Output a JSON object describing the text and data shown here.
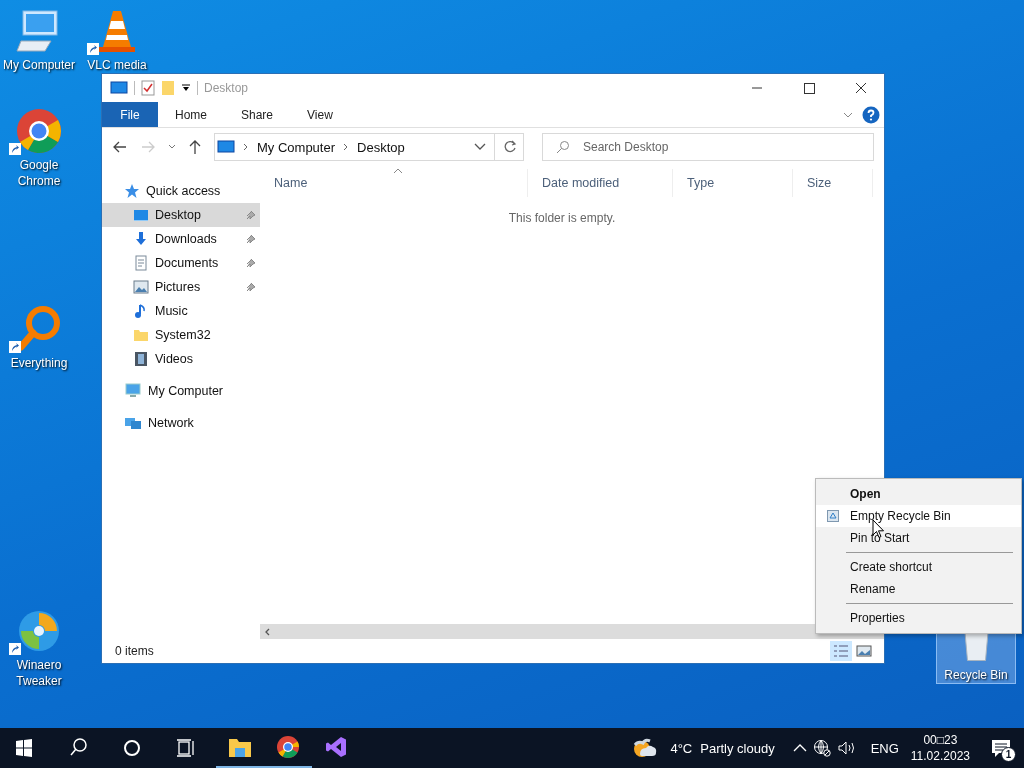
{
  "desktop_icons": [
    {
      "label": "My Computer",
      "kind": "computer",
      "shortcut": false,
      "selected": false
    },
    {
      "label": "VLC media",
      "kind": "cone",
      "shortcut": true,
      "selected": false
    },
    {
      "label": "Google Chrome",
      "kind": "chrome",
      "shortcut": true,
      "selected": false
    },
    {
      "label": "Everything",
      "kind": "magnifier",
      "shortcut": true,
      "selected": false
    },
    {
      "label": "Winaero Tweaker",
      "kind": "swirl",
      "shortcut": true,
      "selected": false
    },
    {
      "label": "Recycle Bin",
      "kind": "bin",
      "shortcut": false,
      "selected": true
    }
  ],
  "window": {
    "title": "Desktop",
    "ribbon_tabs": [
      {
        "label": "File",
        "selected": true
      },
      {
        "label": "Home",
        "selected": false
      },
      {
        "label": "Share",
        "selected": false
      },
      {
        "label": "View",
        "selected": false
      }
    ],
    "address": [
      "My Computer",
      "Desktop"
    ],
    "search": {
      "placeholder": "Search Desktop"
    },
    "nav": [
      {
        "label": "Quick access",
        "kind": "star",
        "children": [
          {
            "label": "Desktop",
            "kind": "desktop",
            "pinned": true,
            "selected": true
          },
          {
            "label": "Downloads",
            "kind": "download",
            "pinned": true,
            "selected": false
          },
          {
            "label": "Documents",
            "kind": "document",
            "pinned": true,
            "selected": false
          },
          {
            "label": "Pictures",
            "kind": "pictures",
            "pinned": true,
            "selected": false
          },
          {
            "label": "Music",
            "kind": "music",
            "pinned": false,
            "selected": false
          },
          {
            "label": "System32",
            "kind": "folder",
            "pinned": false,
            "selected": false
          },
          {
            "label": "Videos",
            "kind": "video",
            "pinned": false,
            "selected": false
          }
        ]
      },
      {
        "label": "My Computer",
        "kind": "computer"
      },
      {
        "label": "Network",
        "kind": "network"
      }
    ],
    "columns": [
      "Name",
      "Date modified",
      "Type",
      "Size"
    ],
    "empty_message": "This folder is empty.",
    "status": "0 items"
  },
  "context_menu": [
    {
      "kind": "item",
      "label": "Open",
      "default": true,
      "highlighted": false,
      "icon": false
    },
    {
      "kind": "item",
      "label": "Empty Recycle Bin",
      "default": false,
      "highlighted": true,
      "icon": true
    },
    {
      "kind": "item",
      "label": "Pin to Start",
      "default": false,
      "highlighted": false,
      "icon": false
    },
    {
      "kind": "separator"
    },
    {
      "kind": "item",
      "label": "Create shortcut",
      "default": false,
      "highlighted": false,
      "icon": false
    },
    {
      "kind": "item",
      "label": "Rename",
      "default": false,
      "highlighted": false,
      "icon": false
    },
    {
      "kind": "separator"
    },
    {
      "kind": "item",
      "label": "Properties",
      "default": false,
      "highlighted": false,
      "icon": false
    }
  ],
  "taskbar": {
    "apps": [
      {
        "kind": "explorer",
        "running": true
      },
      {
        "kind": "chrome",
        "running": true
      },
      {
        "kind": "studio",
        "running": false
      }
    ],
    "weather": {
      "temperature": "4°C",
      "condition": "Partly cloudy"
    },
    "language": "ENG",
    "time": "00□23",
    "date": "11.02.2023",
    "notifications": "1"
  }
}
